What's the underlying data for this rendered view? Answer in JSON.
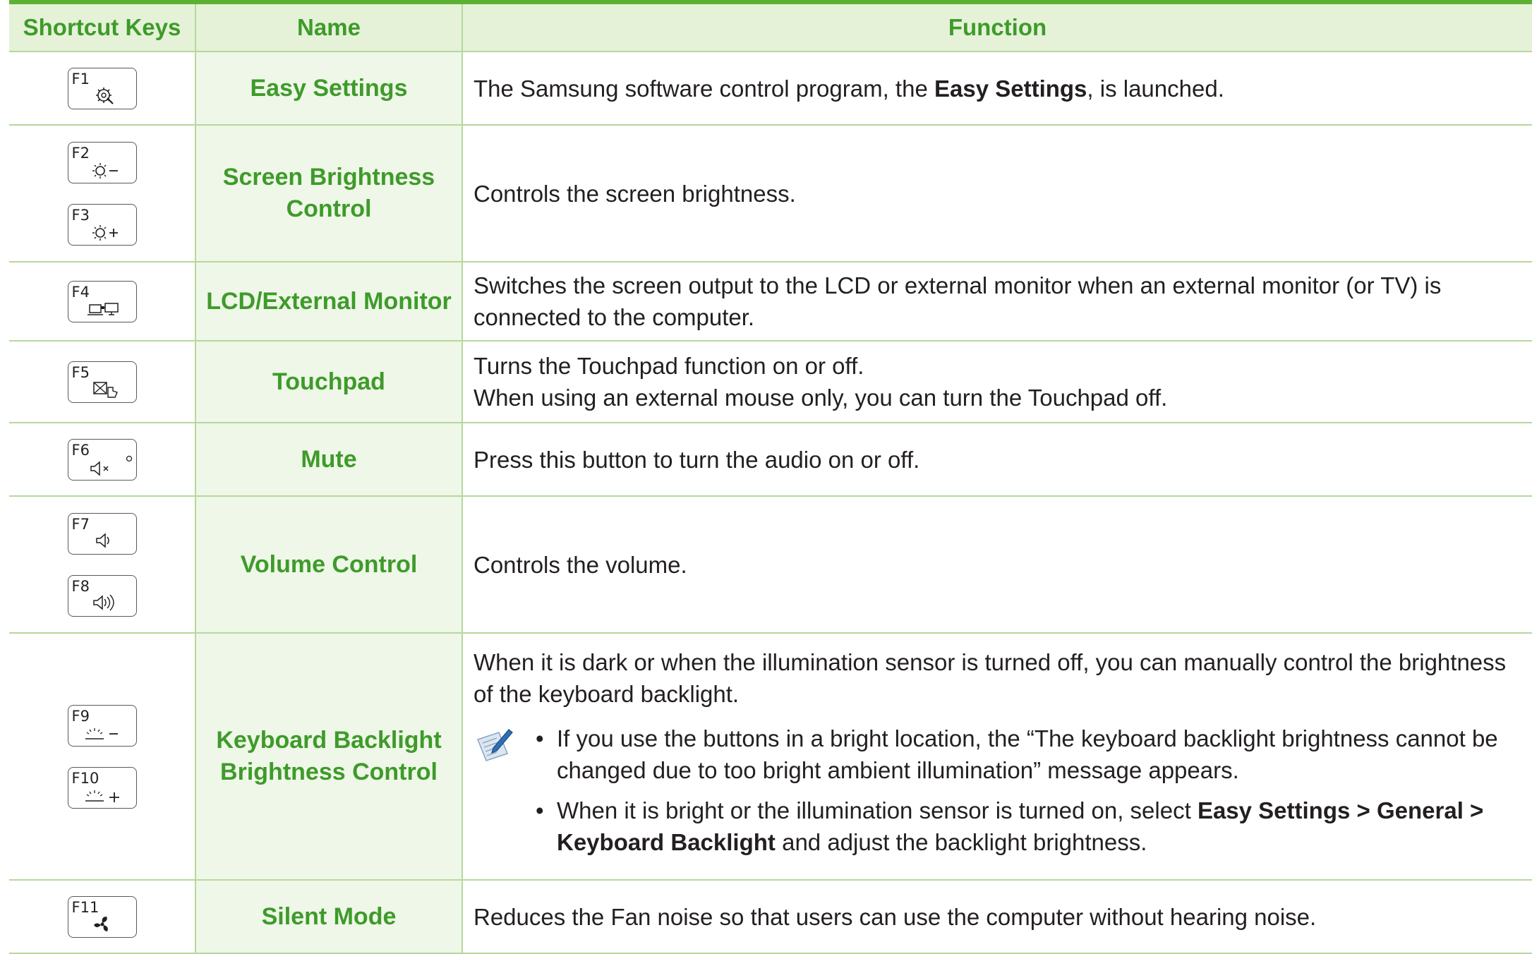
{
  "headers": {
    "keys": "Shortcut Keys",
    "name": "Name",
    "function": "Function"
  },
  "rows": {
    "easy": {
      "key1": "F1",
      "name": "Easy Settings",
      "func_a": "The Samsung software control program, the ",
      "func_b": "Easy Settings",
      "func_c": ", is launched."
    },
    "bright": {
      "key1": "F2",
      "key2": "F3",
      "name_1": "Screen Brightness",
      "name_2": "Control",
      "func": "Controls the screen brightness."
    },
    "lcd": {
      "key1": "F4",
      "name": "LCD/External Monitor",
      "func": "Switches the screen output to the LCD or external monitor when an external monitor (or TV) is connected to the computer."
    },
    "touch": {
      "key1": "F5",
      "name": "Touchpad",
      "func_1": "Turns the Touchpad function on or off.",
      "func_2": "When using an external mouse only, you can turn the Touchpad off."
    },
    "mute": {
      "key1": "F6",
      "name": "Mute",
      "func": "Press this button to turn the audio on or off."
    },
    "volume": {
      "key1": "F7",
      "key2": "F8",
      "name": "Volume Control",
      "func": "Controls the volume."
    },
    "kbd": {
      "key1": "F9",
      "key2": "F10",
      "name_1": "Keyboard Backlight",
      "name_2": "Brightness Control",
      "func": "When it is dark or when the illumination sensor is turned off, you can manually control the brightness of the keyboard backlight.",
      "bullet_1": "If you use the buttons in a bright location, the “The keyboard backlight brightness cannot be changed due to too bright ambient illumination” message appears.",
      "bullet_2_a": "When it is bright or the illumination sensor is turned on, select ",
      "bullet_2_b": "Easy Settings > General > Keyboard Backlight",
      "bullet_2_c": " and adjust the backlight brightness."
    },
    "silent": {
      "key1": "F11",
      "name": "Silent Mode",
      "func": "Reduces the Fan noise so that users can use the computer without hearing noise."
    }
  },
  "icons": {
    "f1": "gear-wrench-icon",
    "f2": "brightness-down-icon",
    "f3": "brightness-up-icon",
    "f4": "lcd-monitor-icon",
    "f5": "touchpad-icon",
    "f6": "mute-icon",
    "f7": "volume-down-icon",
    "f8": "volume-up-icon",
    "f9": "kbd-backlight-down-icon",
    "f10": "kbd-backlight-up-icon",
    "f11": "fan-icon",
    "note": "note-pencil-icon"
  },
  "colors": {
    "accent": "#3e9b2a",
    "header_bg": "#e5f2d8",
    "name_bg": "#eff7e8"
  }
}
